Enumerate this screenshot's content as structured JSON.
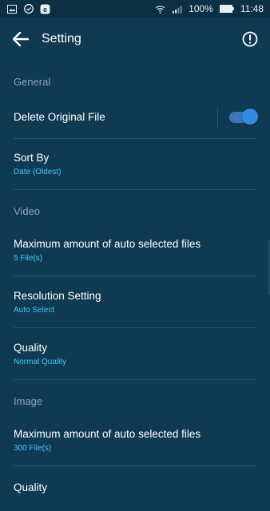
{
  "status": {
    "battery": "100%",
    "time": "11:48",
    "left_icons": [
      "image-icon",
      "check-circle-icon",
      "e-icon"
    ],
    "right_icons": [
      "wifi-icon",
      "signal-icon",
      "battery-icon"
    ]
  },
  "appbar": {
    "title": "Setting"
  },
  "general": {
    "header": "General",
    "delete_original": {
      "label": "Delete Original File",
      "enabled": true
    },
    "sort_by": {
      "label": "Sort By",
      "value": "Date (Oldest)"
    }
  },
  "video": {
    "header": "Video",
    "max_auto": {
      "label": "Maximum amount of auto selected files",
      "value": "5 File(s)"
    },
    "resolution": {
      "label": "Resolution Setting",
      "value": "Auto Select"
    },
    "quality": {
      "label": "Quality",
      "value": "Normal Quality"
    }
  },
  "image": {
    "header": "Image",
    "max_auto": {
      "label": "Maximum amount of auto selected files",
      "value": "300 File(s)"
    },
    "quality": {
      "label": "Quality"
    }
  },
  "colors": {
    "background": "#0f3a52",
    "accent": "#3fc8ff",
    "toggle": "#2f8be3"
  }
}
